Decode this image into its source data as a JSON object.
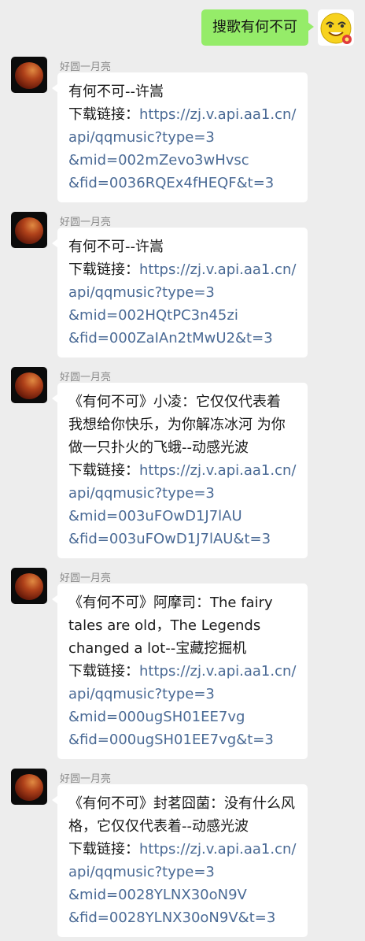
{
  "colors": {
    "background": "#ededed",
    "outgoing_bubble": "#95ec69",
    "incoming_bubble": "#ffffff",
    "link": "#4a6a95",
    "sender_name": "#8b8b8b"
  },
  "outgoing": {
    "text": "搜歌有何不可",
    "avatar_icon": "yellow-smiley-avatar-icon"
  },
  "messages": [
    {
      "sender": "好圆一月亮",
      "avatar_icon": "red-moon-avatar-icon",
      "title_lines": [
        "有何不可--许嵩"
      ],
      "download_label": "下载链接：",
      "url_lines": [
        "https://zj.v.api.aa1.cn/",
        "api/qqmusic?type=3",
        "&mid=002mZevo3wHvsc",
        "&fid=0036RQEx4fHEQF&t=3"
      ]
    },
    {
      "sender": "好圆一月亮",
      "avatar_icon": "red-moon-avatar-icon",
      "title_lines": [
        "有何不可--许嵩"
      ],
      "download_label": "下载链接：",
      "url_lines": [
        "https://zj.v.api.aa1.cn/",
        "api/qqmusic?type=3",
        "&mid=002HQtPC3n45zi",
        "&fid=000ZaIAn2tMwU2&t=3"
      ]
    },
    {
      "sender": "好圆一月亮",
      "avatar_icon": "red-moon-avatar-icon",
      "title_lines": [
        "《有何不可》小凌：它仅仅代表着",
        "我想给你快乐，为你解冻冰河 为你",
        "做一只扑火的飞蛾--动感光波"
      ],
      "download_label": "下载链接：",
      "url_lines": [
        "https://zj.v.api.aa1.cn/",
        "api/qqmusic?type=3",
        "&mid=003uFOwD1J7lAU",
        "&fid=003uFOwD1J7lAU&t=3"
      ]
    },
    {
      "sender": "好圆一月亮",
      "avatar_icon": "red-moon-avatar-icon",
      "title_lines": [
        "《有何不可》阿摩司：The fairy",
        "tales are old，The Legends",
        "changed a lot--宝藏挖掘机"
      ],
      "download_label": "下载链接：",
      "url_lines": [
        "https://zj.v.api.aa1.cn/",
        "api/qqmusic?type=3",
        "&mid=000ugSH01EE7vg",
        "&fid=000ugSH01EE7vg&t=3"
      ]
    },
    {
      "sender": "好圆一月亮",
      "avatar_icon": "red-moon-avatar-icon",
      "title_lines": [
        "《有何不可》封茗囧菌：没有什么风",
        "格，它仅仅代表着--动感光波"
      ],
      "download_label": "下载链接：",
      "url_lines": [
        "https://zj.v.api.aa1.cn/",
        "api/qqmusic?type=3",
        "&mid=0028YLNX30oN9V",
        "&fid=0028YLNX30oN9V&t=3"
      ]
    }
  ]
}
